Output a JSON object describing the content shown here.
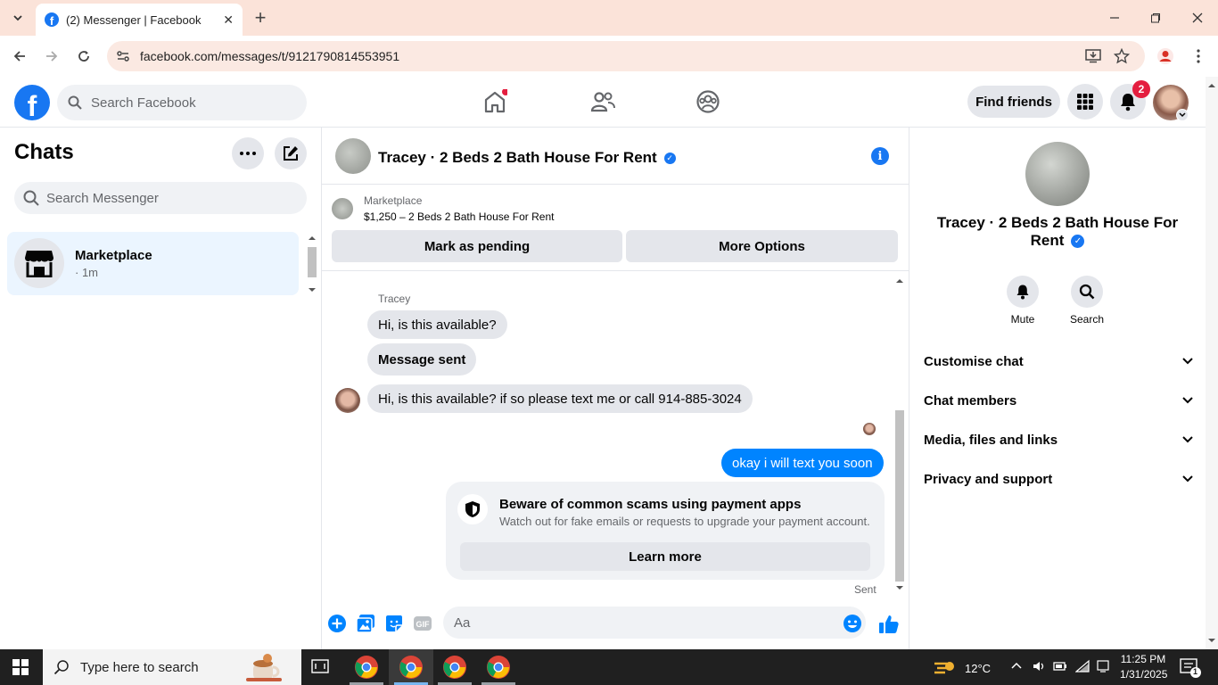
{
  "browser": {
    "tab_title": "(2) Messenger | Facebook",
    "url": "facebook.com/messages/t/9121790814553951"
  },
  "fbnav": {
    "search_placeholder": "Search Facebook",
    "find_friends": "Find friends",
    "notification_count": "2"
  },
  "left": {
    "title": "Chats",
    "search_placeholder": "Search Messenger",
    "chats": [
      {
        "name": "Marketplace",
        "time": "· 1m"
      }
    ]
  },
  "chat": {
    "header_name": "Tracey · 2 Beds 2 Bath House For Rent",
    "marketplace_label": "Marketplace",
    "listing": "$1,250 – 2 Beds 2 Bath House For Rent",
    "mark_pending": "Mark as pending",
    "more_options": "More Options",
    "sender": "Tracey",
    "messages": [
      "Hi, is this available?",
      "Message sent",
      "Hi, is this available? if so please text me or call 914-885-3024",
      "okay i will text you soon"
    ],
    "scam_title": "Beware of common scams using payment apps",
    "scam_sub": "Watch out for fake emails or requests to upgrade your payment account.",
    "learn_more": "Learn more",
    "sent": "Sent",
    "composer_placeholder": "Aa"
  },
  "right": {
    "name": "Tracey · 2 Beds 2 Bath House For Rent",
    "mute": "Mute",
    "search": "Search",
    "sections": [
      "Customise chat",
      "Chat members",
      "Media, files and links",
      "Privacy and support"
    ]
  },
  "taskbar": {
    "search_placeholder": "Type here to search",
    "temp": "12°C",
    "time": "11:25 PM",
    "date": "1/31/2025",
    "notif": "1"
  },
  "colors": {
    "fb_blue": "#1877f2",
    "messenger_blue": "#0084ff",
    "selected_chat": "#ebf5ff"
  }
}
